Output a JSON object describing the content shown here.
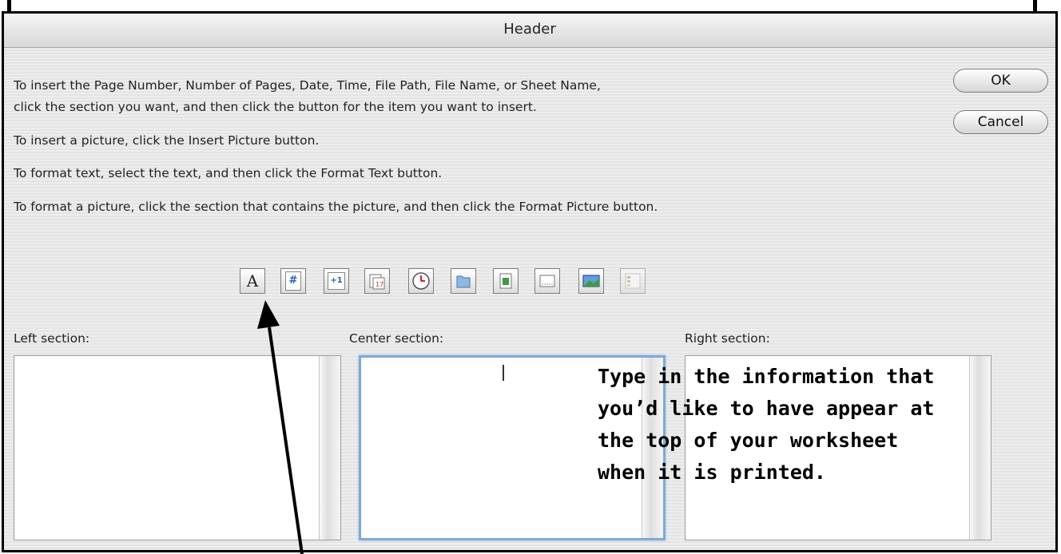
{
  "dialog": {
    "title": "Header",
    "instructions": [
      "To insert the Page Number, Number of Pages, Date, Time, File Path, File Name, or Sheet Name,",
      "click the section you want, and then click the button for the item you want to insert.",
      "To insert a picture, click the Insert Picture button.",
      "To format text, select the text, and then click the Format Text button.",
      "To format a picture, click the section that contains the picture, and then click the Format Picture button."
    ],
    "ok_label": "OK",
    "cancel_label": "Cancel"
  },
  "toolbar": {
    "buttons": [
      {
        "icon": "format-text-icon",
        "glyph": "A"
      },
      {
        "icon": "page-number-icon",
        "glyph": "#"
      },
      {
        "icon": "number-of-pages-icon",
        "glyph": "+1"
      },
      {
        "icon": "date-icon"
      },
      {
        "icon": "time-icon"
      },
      {
        "icon": "file-path-icon"
      },
      {
        "icon": "file-name-icon"
      },
      {
        "icon": "sheet-name-icon"
      },
      {
        "icon": "insert-picture-icon"
      },
      {
        "icon": "format-picture-icon"
      }
    ]
  },
  "sections": {
    "left_label": "Left section:",
    "center_label": "Center section:",
    "right_label": "Right section:",
    "left_value": "",
    "center_value": "",
    "right_value": ""
  },
  "annotation": {
    "lines": [
      "Type in the information that",
      "you’d like to have appear at",
      "the top of your worksheet",
      "when it is printed."
    ]
  }
}
